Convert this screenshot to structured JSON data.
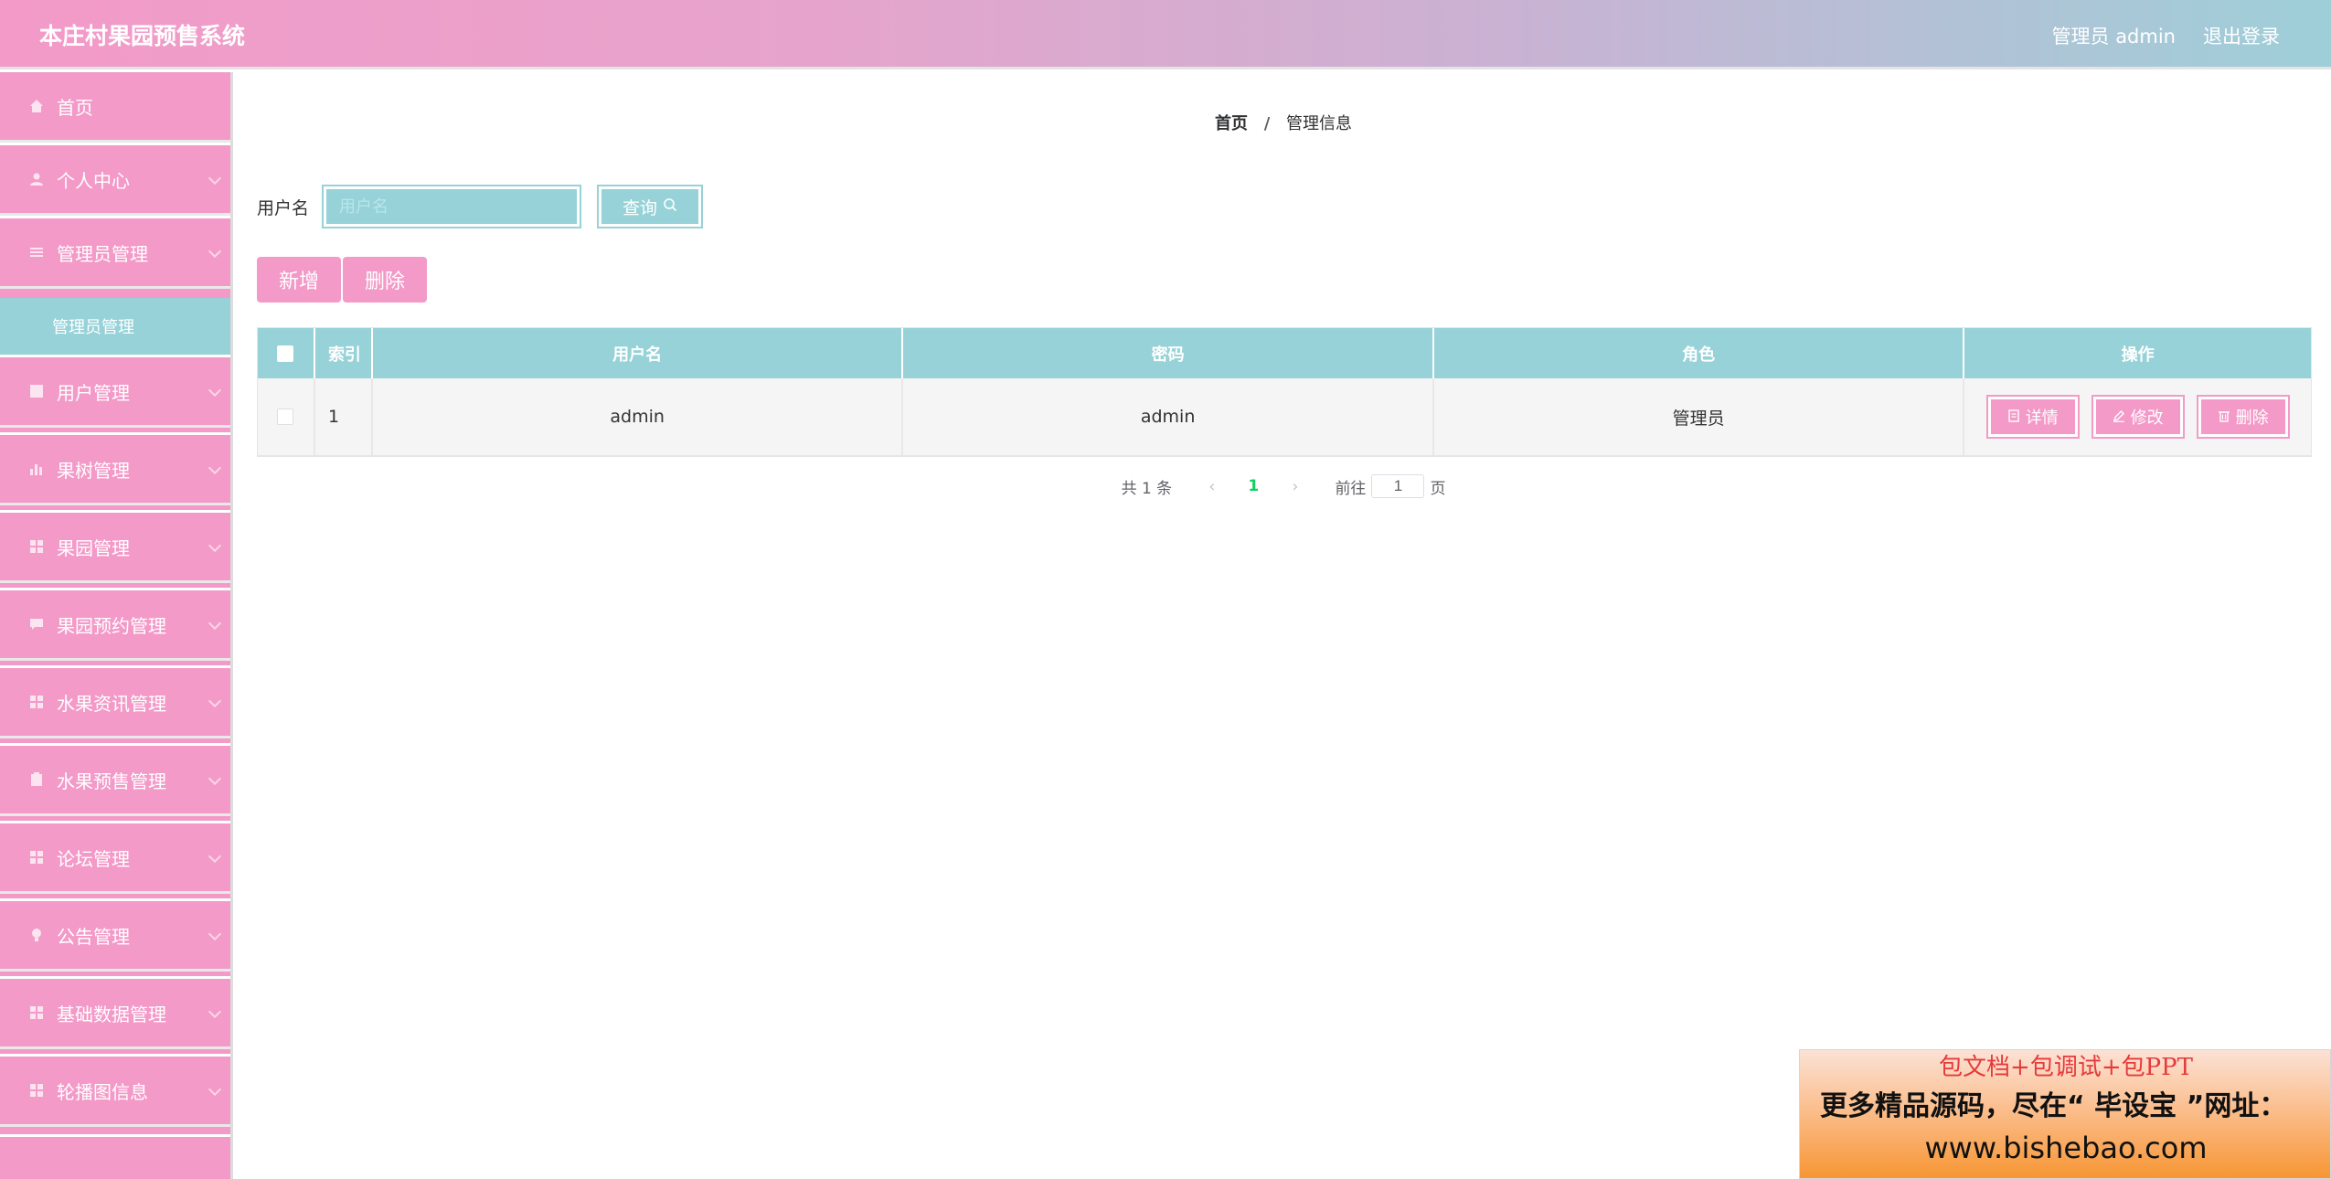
{
  "header": {
    "app_title": "本庄村果园预售系统",
    "user_label": "管理员 admin",
    "logout_label": "退出登录"
  },
  "sidebar": {
    "items": [
      {
        "label": "首页",
        "icon": "home-icon"
      },
      {
        "label": "个人中心",
        "icon": "user-icon"
      },
      {
        "label": "管理员管理",
        "icon": "list-icon"
      },
      {
        "label": "用户管理",
        "icon": "grid-icon"
      },
      {
        "label": "果树管理",
        "icon": "bar-chart-icon"
      },
      {
        "label": "果园管理",
        "icon": "grid-icon"
      },
      {
        "label": "果园预约管理",
        "icon": "message-icon"
      },
      {
        "label": "水果资讯管理",
        "icon": "grid-icon"
      },
      {
        "label": "水果预售管理",
        "icon": "clipboard-icon"
      },
      {
        "label": "论坛管理",
        "icon": "grid-icon"
      },
      {
        "label": "公告管理",
        "icon": "bulb-icon"
      },
      {
        "label": "基础数据管理",
        "icon": "grid-icon"
      },
      {
        "label": "轮播图信息",
        "icon": "grid-icon"
      }
    ],
    "active_sub_item": "管理员管理"
  },
  "breadcrumb": {
    "home": "首页",
    "separator": "/",
    "current": "管理信息"
  },
  "search": {
    "label": "用户名",
    "placeholder": "用户名",
    "value": "",
    "query_label": "查询"
  },
  "actions": {
    "add_label": "新增",
    "delete_label": "删除"
  },
  "table": {
    "columns": [
      "索引",
      "用户名",
      "密码",
      "角色",
      "操作"
    ],
    "rows": [
      {
        "index": "1",
        "username": "admin",
        "password": "admin",
        "role": "管理员"
      }
    ],
    "row_actions": {
      "detail": "详情",
      "edit": "修改",
      "delete": "删除"
    }
  },
  "pagination": {
    "total_text": "共 1 条",
    "current_page": "1",
    "goto_prefix": "前往",
    "goto_value": "1",
    "goto_suffix": "页"
  },
  "ad": {
    "line1": "包文档+包调试+包PPT",
    "line2": "更多精品源码，尽在“ 毕设宝 ”网址：",
    "line3": "www.bishebao.com"
  },
  "colors": {
    "pink": "#f39ac8",
    "teal": "#96d2d8",
    "page_active": "#13ce66"
  }
}
